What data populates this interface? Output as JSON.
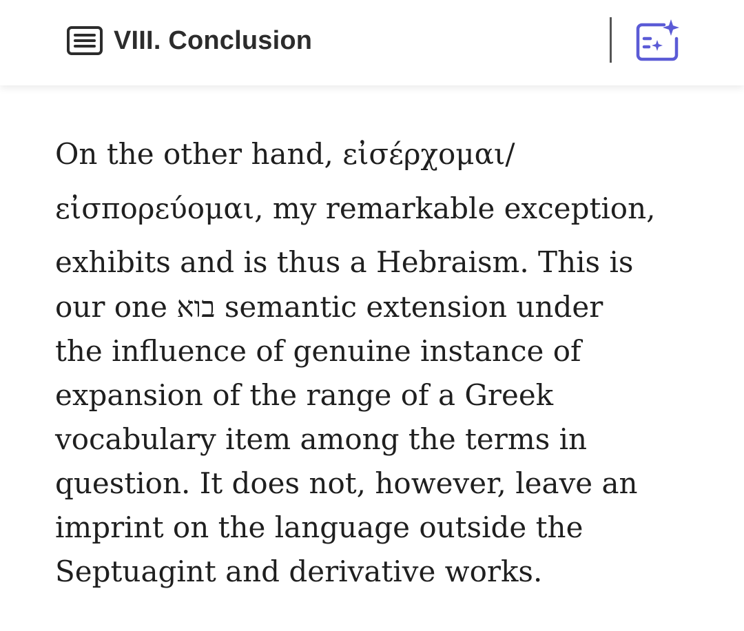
{
  "header": {
    "section_title": "VIII. Conclusion",
    "toc_icon": "list-document-icon",
    "ai_icon": "ai-sparkle-document-icon",
    "accent_color": "#5b5bd6",
    "text_color": "#2c2c2c"
  },
  "content": {
    "lines": [
      "On the other hand, εἰσέρχομαι/",
      "εἰσπορεύομαι, my remarkable exception,",
      "exhibits and is thus a Hebraism. This is",
      "our one בוא semantic extension under",
      "the influence of genuine instance of",
      "expansion of the range of a Greek",
      "vocabulary item among the terms in",
      "question. It does not, however, leave an",
      "imprint on the language outside the",
      "Septuagint and derivative works."
    ]
  }
}
